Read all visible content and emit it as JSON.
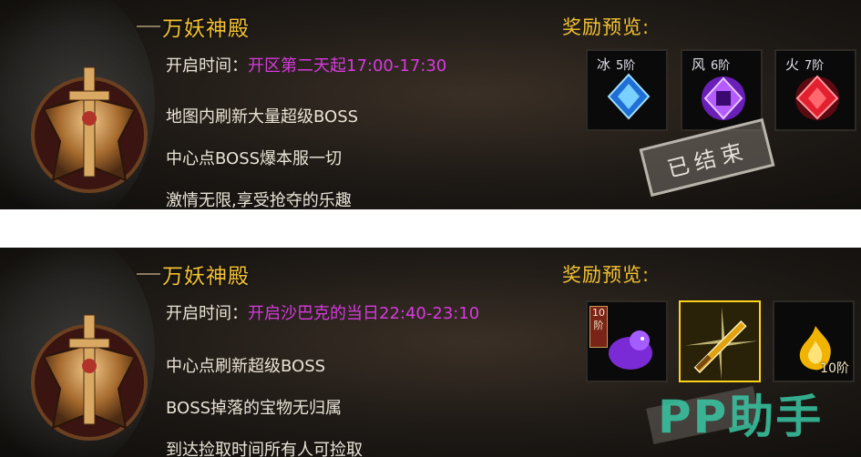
{
  "panels": [
    {
      "title": "万妖神殿",
      "time_label": "开启时间：",
      "time_value": "开区第二天起17:00-17:30",
      "descriptions": [
        "地图内刷新大量超级BOSS",
        "中心点BOSS爆本服一切",
        "激情无限,享受抢夺的乐趣"
      ],
      "reward_title": "奖励预览:",
      "rewards": [
        {
          "name": "冰",
          "level": "5阶",
          "color": "#3aa8ff",
          "icon": "ice-gem-icon"
        },
        {
          "name": "风",
          "level": "6阶",
          "color": "#b04bff",
          "icon": "wind-gem-icon"
        },
        {
          "name": "火",
          "level": "7阶",
          "color": "#ff2a3a",
          "icon": "fire-gem-icon"
        }
      ],
      "stamp": "已结束"
    },
    {
      "title": "万妖神殿",
      "time_label": "开启时间：",
      "time_value": "开启沙巴克的当日22:40-23:10",
      "descriptions": [
        "中心点刷新超级BOSS",
        "BOSS掉落的宝物无归属",
        "到达捡取时间所有人可捡取"
      ],
      "reward_title": "奖励预览:",
      "rewards": [
        {
          "badge": "10阶",
          "color": "#9b42ff",
          "icon": "purple-beast-icon"
        },
        {
          "color": "#ffd21a",
          "icon": "golden-sword-icon"
        },
        {
          "level": "10阶",
          "color": "#ffc400",
          "icon": "golden-flame-icon"
        }
      ]
    }
  ],
  "watermark": "PP助手",
  "colors": {
    "title": "#f2c233",
    "time_value": "#d73adf",
    "text": "#e9e3d6"
  }
}
